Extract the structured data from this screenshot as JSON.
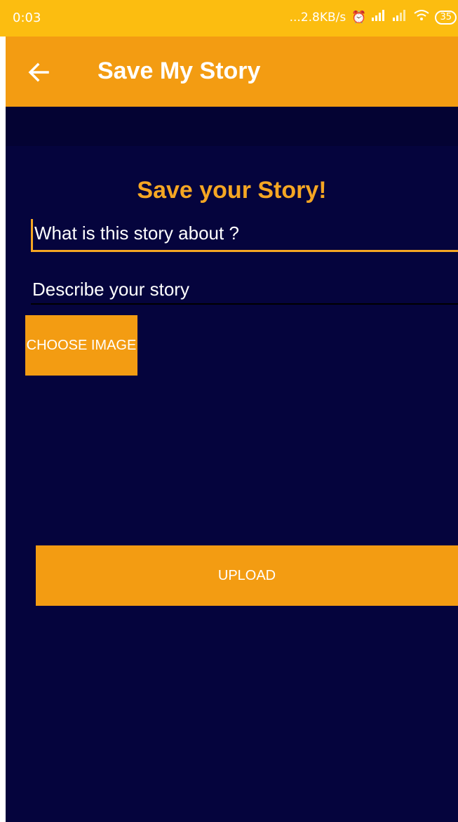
{
  "status_bar": {
    "time": "0:03",
    "speed": "...2.8KB/s",
    "battery": "35"
  },
  "app_bar": {
    "title": "Save My Story",
    "back_icon": "arrow-left-icon"
  },
  "form": {
    "heading": "Save your Story!",
    "about_placeholder": "What is this story about ?",
    "description_placeholder": "Describe your story",
    "choose_image_label": "CHOOSE IMAGE",
    "upload_label": "UPLOAD"
  },
  "colors": {
    "status_bar": "#fcbd10",
    "app_bar": "#f39c12",
    "background": "#05043d",
    "accent": "#f5a623"
  }
}
